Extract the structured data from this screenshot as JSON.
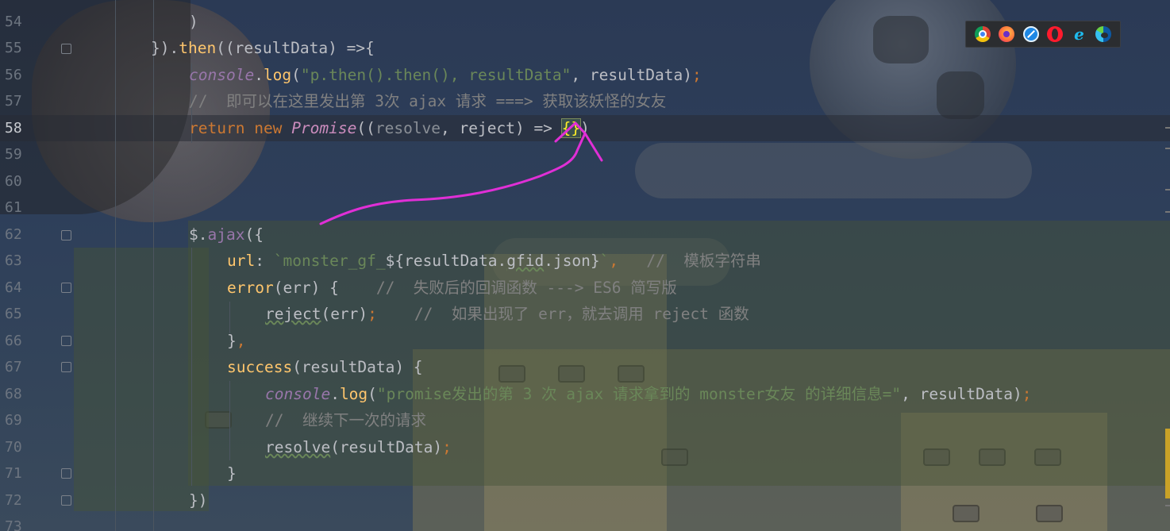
{
  "gutter": {
    "line_numbers": [
      "54",
      "55",
      "56",
      "57",
      "58",
      "59",
      "60",
      "61",
      "62",
      "63",
      "64",
      "65",
      "66",
      "67",
      "68",
      "69",
      "70",
      "71",
      "72",
      "73"
    ],
    "active_line": "58"
  },
  "code": {
    "l54": ")",
    "l55a": "}).",
    "l55b": "then",
    "l55c": "((resultData) =>{",
    "l56a": "console",
    "l56b": ".",
    "l56c": "log",
    "l56d": "(",
    "l56e": "\"p.then().then(), resultData\"",
    "l56f": ", resultData)",
    "l56g": ";",
    "l57": "//  即可以在这里发出第 3次 ajax 请求 ===> 获取该妖怪的女友",
    "l58a": "return",
    "l58b": " ",
    "l58c": "new",
    "l58d": " ",
    "l58e": "Promise",
    "l58f": "((",
    "l58g": "resolve",
    "l58h": ", reject) => ",
    "l58i": "{}",
    "l58j": ")",
    "l62a": "$",
    "l62b": ".",
    "l62c": "ajax",
    "l62d": "({",
    "l63a": "url",
    "l63b": ": ",
    "l63c": "`monster_gf_",
    "l63d": "${resultData.",
    "l63e": "gfid",
    "l63f": ".",
    "l63g": "json",
    "l63h": "}",
    "l63i": "`",
    "l63j": ",",
    "l63k": "   //  模板字符串",
    "l64a": "error",
    "l64b": "(err) {",
    "l64c": "    //  失败后的回调函数 ---> ES6 简写版",
    "l65a": "reject",
    "l65b": "(err)",
    "l65c": ";",
    "l65d": "    //  如果出现了 err，就去调用 reject 函数",
    "l66a": "}",
    "l66b": ",",
    "l67a": "success",
    "l67b": "(resultData) {",
    "l68a": "console",
    "l68b": ".",
    "l68c": "log",
    "l68d": "(",
    "l68e": "\"promise发出的第 3 次 ajax 请求拿到的 monster女友 的详细信息=\"",
    "l68f": ", resultData)",
    "l68g": ";",
    "l69": "//  继续下一次的请求",
    "l70a": "resolve",
    "l70b": "(resultData)",
    "l70c": ";",
    "l71": "}",
    "l72": "})"
  },
  "browser_icons": [
    "chrome-icon",
    "firefox-icon",
    "safari-icon",
    "opera-icon",
    "ie-icon",
    "edge-icon"
  ],
  "ie_glyph": "e",
  "colors": {
    "keyword": "#cc7832",
    "function": "#ffc66d",
    "string": "#6a8759",
    "comment": "#808080",
    "annotation_stroke": "#e02fd6"
  }
}
